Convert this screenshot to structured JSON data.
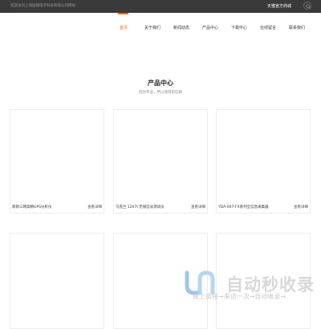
{
  "topbar": {
    "welcome": "欢迎访问上海国瑞电子科技有限公司网站",
    "store": "天猫官方商城",
    "search_icon": "search-icon"
  },
  "nav": {
    "items": [
      {
        "label": "首页",
        "active": true
      },
      {
        "label": "关于我们",
        "active": false
      },
      {
        "label": "新闻动态",
        "active": false
      },
      {
        "label": "产品中心",
        "active": false
      },
      {
        "label": "下载中心",
        "active": false
      },
      {
        "label": "在线留言",
        "active": false
      },
      {
        "label": "联系我们",
        "active": false
      }
    ],
    "accent": "#e8701f"
  },
  "products": {
    "title": "产品中心",
    "subtitle": "因为专业，所以值得您信赖",
    "items": [
      {
        "title": "新款三网高精GPS分析仪",
        "link": "查看详细"
      },
      {
        "title": "乌克兰 1207I 无线信号测试仪",
        "link": "查看详细"
      },
      {
        "title": "YDA-007-FX系列全信息采集器",
        "link": "查看详细"
      },
      {
        "title": "",
        "link": ""
      },
      {
        "title": "",
        "link": ""
      },
      {
        "title": "",
        "link": ""
      }
    ]
  },
  "watermark": {
    "text": "自动秒收录",
    "subtext": "做上链接→来访一次→自动收录→"
  }
}
